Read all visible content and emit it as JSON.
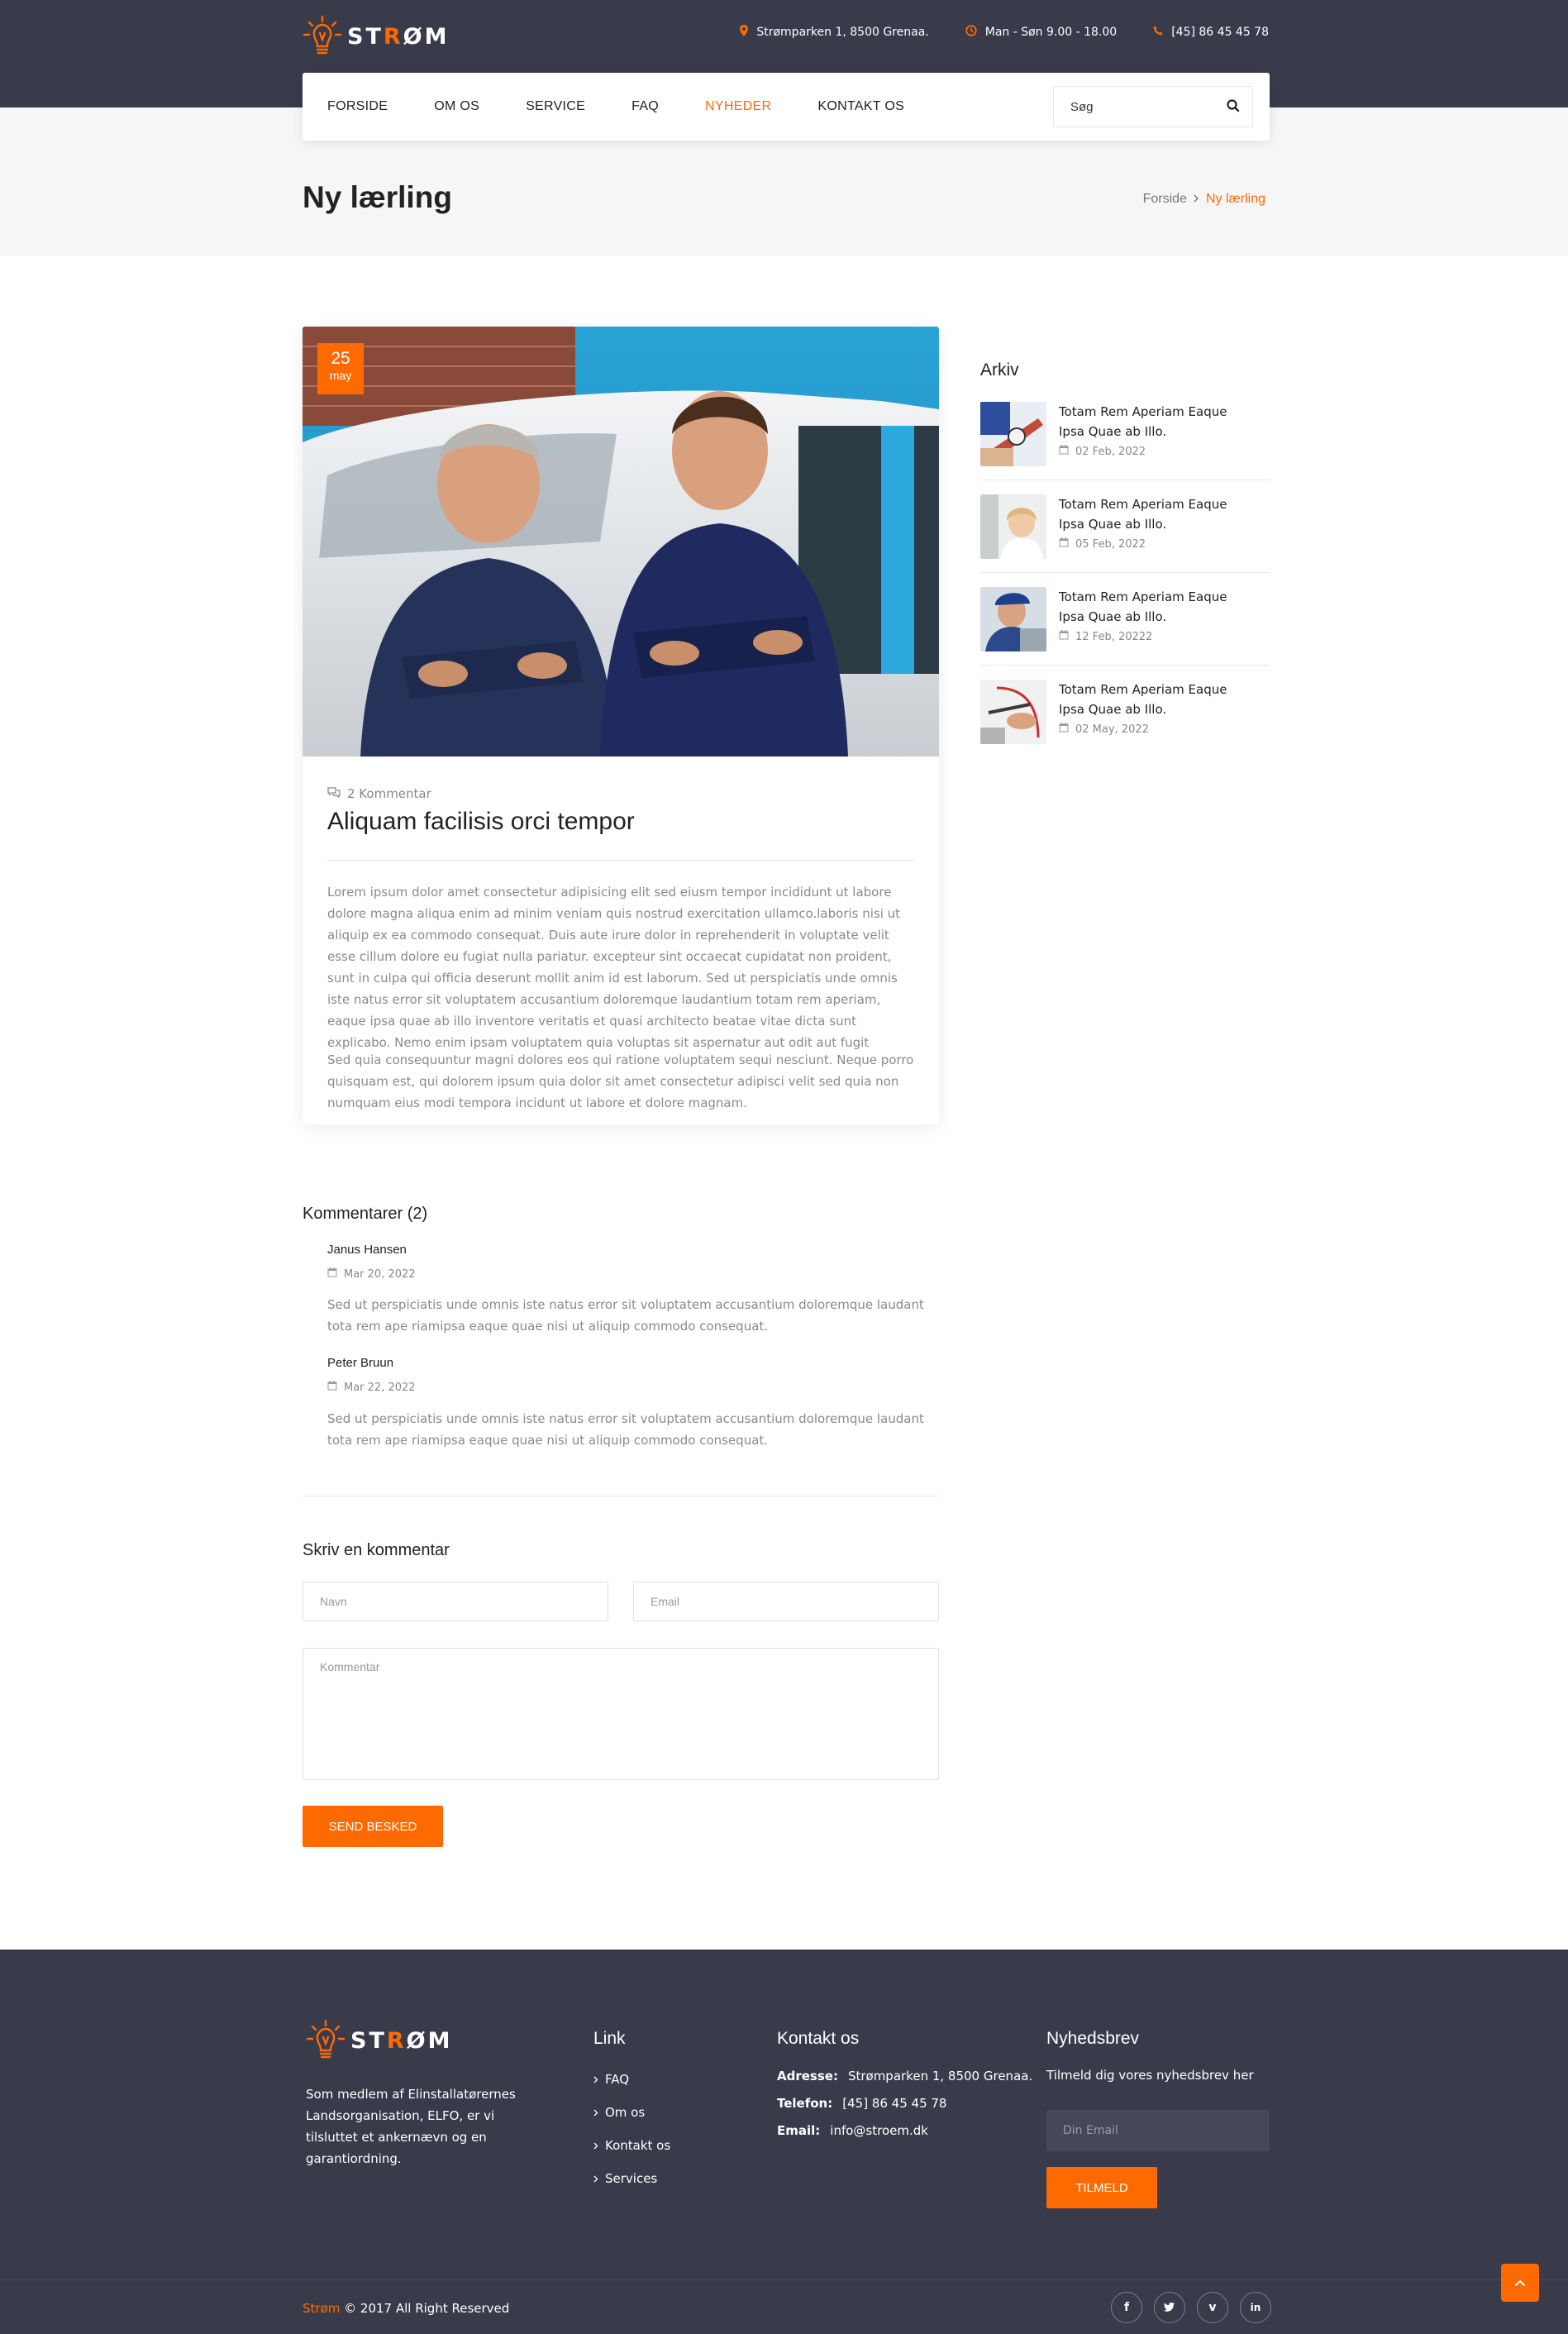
{
  "brand": {
    "name": "STRØM",
    "accent": "#ff6a00",
    "dark": "#393b4b"
  },
  "header": {
    "address": "Strømparken 1, 8500 Grenaa.",
    "hours": "Man - Søn 9.00 - 18.00",
    "phone": "[45] 86 45 45 78",
    "icons": {
      "address": "map-marker-icon",
      "hours": "clock-icon",
      "phone": "phone-icon"
    }
  },
  "nav": {
    "items": [
      {
        "label": "FORSIDE",
        "active": false
      },
      {
        "label": "OM OS",
        "active": false
      },
      {
        "label": "SERVICE",
        "active": false
      },
      {
        "label": "FAQ",
        "active": false
      },
      {
        "label": "NYHEDER",
        "active": true
      },
      {
        "label": "KONTAKT OS",
        "active": false
      }
    ],
    "search_placeholder": "Søg"
  },
  "page": {
    "title": "Ny lærling",
    "breadcrumb": {
      "home": "Forside",
      "current": "Ny lærling"
    }
  },
  "post": {
    "date_day": "25",
    "date_month": "may",
    "comments_meta": "2 Kommentar",
    "title": "Aliquam facilisis orci tempor",
    "paragraph1": "Lorem ipsum dolor amet consectetur adipisicing elit sed eiusm tempor incididunt ut labore dolore magna aliqua enim ad minim veniam quis nostrud exercitation ullamco.laboris nisi ut aliquip ex ea commodo consequat. Duis aute irure dolor in reprehenderit in voluptate velit esse cillum dolore eu fugiat nulla pariatur. excepteur sint occaecat cupidatat non proident, sunt in culpa qui officia deserunt mollit anim id est laborum. Sed ut perspiciatis unde omnis iste natus error sit voluptatem accusantium doloremque laudantium totam rem aperiam, eaque ipsa quae ab illo inventore veritatis et quasi architecto beatae vitae dicta sunt explicabo. Nemo enim ipsam voluptatem quia voluptas sit aspernatur aut odit aut fugit",
    "paragraph2": "Sed quia consequuntur magni dolores eos qui ratione voluptatem sequi nesciunt. Neque porro quisquam est, qui dolorem ipsum quia dolor sit amet consectetur adipisci velit sed quia non numquam eius modi tempora incidunt ut labore et dolore magnam."
  },
  "sidebar": {
    "title": "Arkiv",
    "items": [
      {
        "title": "Totam Rem Aperiam Eaque Ipsa Quae ab Illo.",
        "date": "02 Feb, 2022"
      },
      {
        "title": "Totam Rem Aperiam Eaque Ipsa Quae ab Illo.",
        "date": "05 Feb, 2022"
      },
      {
        "title": "Totam Rem Aperiam Eaque Ipsa Quae ab Illo.",
        "date": "12 Feb, 20222"
      },
      {
        "title": "Totam Rem Aperiam Eaque Ipsa Quae ab Illo.",
        "date": "02 May, 2022"
      }
    ]
  },
  "comments": {
    "title": "Kommentarer (2)",
    "items": [
      {
        "name": "Janus Hansen",
        "date": "Mar 20, 2022",
        "text": "Sed ut perspiciatis unde omnis iste natus error sit voluptatem accusantium doloremque laudant tota rem ape riamipsa eaque quae nisi ut aliquip commodo consequat."
      },
      {
        "name": "Peter Bruun",
        "date": "Mar 22, 2022",
        "text": "Sed ut perspiciatis unde omnis iste natus error sit voluptatem accusantium doloremque laudant tota rem ape riamipsa eaque quae nisi ut aliquip commodo consequat."
      }
    ]
  },
  "form": {
    "title": "Skriv en kommentar",
    "name_placeholder": "Navn",
    "email_placeholder": "Email",
    "comment_placeholder": "Kommentar",
    "submit_label": "SEND BESKED"
  },
  "footer": {
    "about": "Som medlem af Elinstallatørernes Landsorganisation, ELFO, er vi tilsluttet et ankernævn og en garantiordning.",
    "links_title": "Link",
    "links": [
      "FAQ",
      "Om os",
      "Kontakt os",
      "Services"
    ],
    "contact_title": "Kontakt os",
    "contact": [
      {
        "label": "Adresse:",
        "value": "Strømparken 1, 8500 Grenaa."
      },
      {
        "label": "Telefon:",
        "value": "[45] 86 45 45 78"
      },
      {
        "label": "Email:",
        "value": "info@stroem.dk"
      }
    ],
    "newsletter_title": "Nyhedsbrev",
    "newsletter_text": "Tilmeld dig vores nyhedsbrev her",
    "email_placeholder": "Din Email",
    "subscribe_label": "TILMELD",
    "copyright_brand": "Strøm",
    "copyright_rest": "© 2017 All Right Reserved",
    "socials": [
      {
        "icon": "facebook-icon",
        "glyph": "f"
      },
      {
        "icon": "twitter-icon",
        "glyph": "t"
      },
      {
        "icon": "vimeo-icon",
        "glyph": "v"
      },
      {
        "icon": "linkedin-icon",
        "glyph": "in"
      }
    ]
  }
}
